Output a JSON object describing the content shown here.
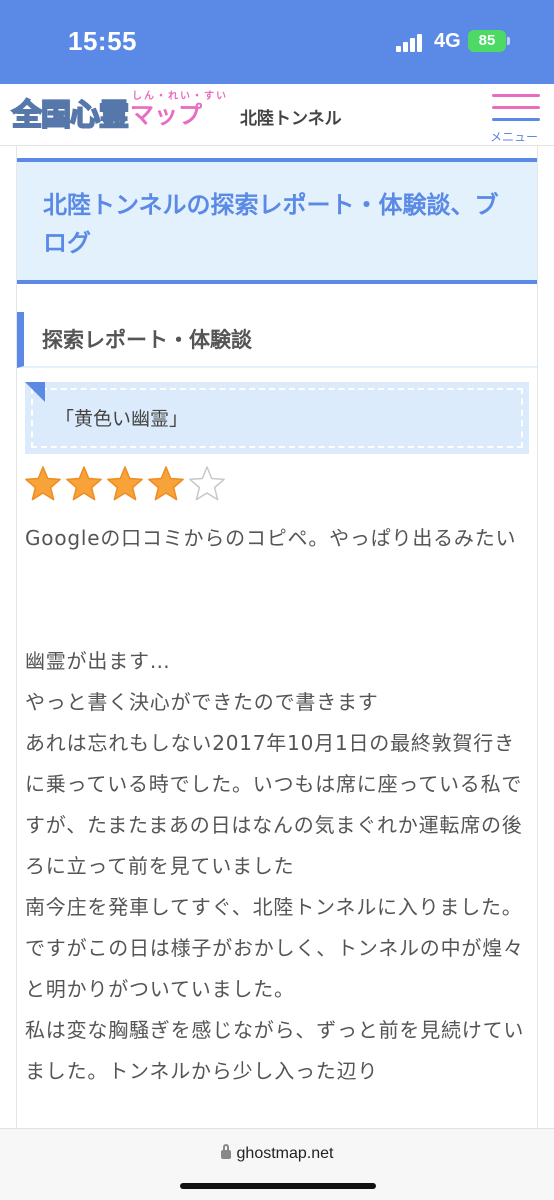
{
  "status_bar": {
    "time": "15:55",
    "network": "4G",
    "battery": "85",
    "battery_color": "#4cd964",
    "background": "#5b8ae6"
  },
  "header": {
    "logo_main": "全国心霊",
    "logo_sub": "マップ",
    "logo_dots": "しん・れい・すい",
    "page_name": "北陸トンネル",
    "menu_label": "メニュー",
    "menu_icon": "hamburger-icon",
    "menu_bar_colors": [
      "#e96cc1",
      "#e96cc1",
      "#5b8ae6"
    ]
  },
  "main": {
    "page_heading": "北陸トンネルの探索レポート・体験談、ブログ",
    "section_heading": "探索レポート・体験談",
    "report_title": "「黄色い幽霊」",
    "rating": {
      "value": 4,
      "max": 5
    },
    "accent_color": "#5b8ae6",
    "article_paragraphs": [
      "Googleの口コミからのコピペ。やっぱり出るみたい",
      "",
      "幽霊が出ます…",
      "やっと書く決心ができたので書きます",
      "あれは忘れもしない2017年10月1日の最終敦賀行きに乗っている時でした。いつもは席に座っている私ですが、たまたまあの日はなんの気まぐれか運転席の後ろに立って前を見ていました",
      "南今庄を発車してすぐ、北陸トンネルに入りました。ですがこの日は様子がおかしく、トンネルの中が煌々と明かりがついていました。",
      "私は変な胸騒ぎを感じながら、ずっと前を見続けていました。トンネルから少し入った辺り"
    ]
  },
  "browser": {
    "url": "ghostmap.net",
    "lock_icon": "lock-icon"
  }
}
